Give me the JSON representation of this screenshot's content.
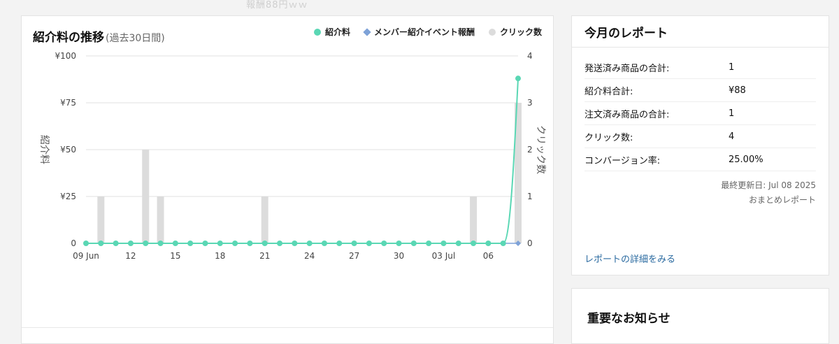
{
  "watermark": "報酬88円ｗｗ",
  "chart_card": {
    "title": "紹介料の推移",
    "subtitle": "(過去30日間)",
    "legend": [
      {
        "label": "紹介料",
        "color": "#5ad7b4",
        "shape": "circle"
      },
      {
        "label": "メンバー紹介イベント報酬",
        "color": "#7ea2d8",
        "shape": "diamond"
      },
      {
        "label": "クリック数",
        "color": "#dcdcdc",
        "shape": "circle"
      }
    ]
  },
  "chart_data": {
    "type": "line",
    "title": "紹介料の推移",
    "subtitle": "(過去30日間)",
    "ylabel": "紹介料",
    "y2label": "クリック数",
    "y_ticks": [
      "¥100",
      "¥75",
      "¥50",
      "¥25",
      "0"
    ],
    "y2_ticks": [
      "4",
      "3",
      "2",
      "1",
      "0"
    ],
    "ylim": [
      0,
      100
    ],
    "y2lim": [
      0,
      4
    ],
    "x_tick_labels": [
      {
        "index": 0,
        "label": "09 Jun"
      },
      {
        "index": 3,
        "label": "12"
      },
      {
        "index": 6,
        "label": "15"
      },
      {
        "index": 9,
        "label": "18"
      },
      {
        "index": 12,
        "label": "21"
      },
      {
        "index": 15,
        "label": "24"
      },
      {
        "index": 18,
        "label": "27"
      },
      {
        "index": 21,
        "label": "30"
      },
      {
        "index": 24,
        "label": "03 Jul"
      },
      {
        "index": 27,
        "label": "06"
      }
    ],
    "x": [
      "2025-06-09",
      "2025-06-10",
      "2025-06-11",
      "2025-06-12",
      "2025-06-13",
      "2025-06-14",
      "2025-06-15",
      "2025-06-16",
      "2025-06-17",
      "2025-06-18",
      "2025-06-19",
      "2025-06-20",
      "2025-06-21",
      "2025-06-22",
      "2025-06-23",
      "2025-06-24",
      "2025-06-25",
      "2025-06-26",
      "2025-06-27",
      "2025-06-28",
      "2025-06-29",
      "2025-06-30",
      "2025-07-01",
      "2025-07-02",
      "2025-07-03",
      "2025-07-04",
      "2025-07-05",
      "2025-07-06",
      "2025-07-07",
      "2025-07-08"
    ],
    "series": [
      {
        "name": "紹介料",
        "axis": "y",
        "type": "line",
        "color": "#5ad7b4",
        "values": [
          0,
          0,
          0,
          0,
          0,
          0,
          0,
          0,
          0,
          0,
          0,
          0,
          0,
          0,
          0,
          0,
          0,
          0,
          0,
          0,
          0,
          0,
          0,
          0,
          0,
          0,
          0,
          0,
          0,
          88
        ]
      },
      {
        "name": "メンバー紹介イベント報酬",
        "axis": "y",
        "type": "line",
        "color": "#7ea2d8",
        "values": [
          0,
          0,
          0,
          0,
          0,
          0,
          0,
          0,
          0,
          0,
          0,
          0,
          0,
          0,
          0,
          0,
          0,
          0,
          0,
          0,
          0,
          0,
          0,
          0,
          0,
          0,
          0,
          0,
          0,
          0
        ]
      },
      {
        "name": "クリック数",
        "axis": "y2",
        "type": "bar",
        "color": "#dcdcdc",
        "values": [
          0,
          1,
          0,
          0,
          2,
          1,
          0,
          0,
          0,
          0,
          0,
          0,
          1,
          0,
          0,
          0,
          0,
          0,
          0,
          0,
          0,
          0,
          0,
          0,
          0,
          0,
          1,
          0,
          0,
          3
        ]
      }
    ],
    "grid": true
  },
  "report": {
    "title": "今月のレポート",
    "rows": [
      {
        "label": "発送済み商品の合計:",
        "value": "1"
      },
      {
        "label": "紹介料合計:",
        "value": "¥88"
      },
      {
        "label": "注文済み商品の合計:",
        "value": "1"
      },
      {
        "label": "クリック数:",
        "value": "4"
      },
      {
        "label": "コンバージョン率:",
        "value": "25.00%"
      }
    ],
    "last_updated": "最終更新日: Jul 08 2025",
    "summary_label": "おまとめレポート",
    "detail_link": "レポートの詳細をみる"
  },
  "notice": {
    "title": "重要なお知らせ"
  }
}
